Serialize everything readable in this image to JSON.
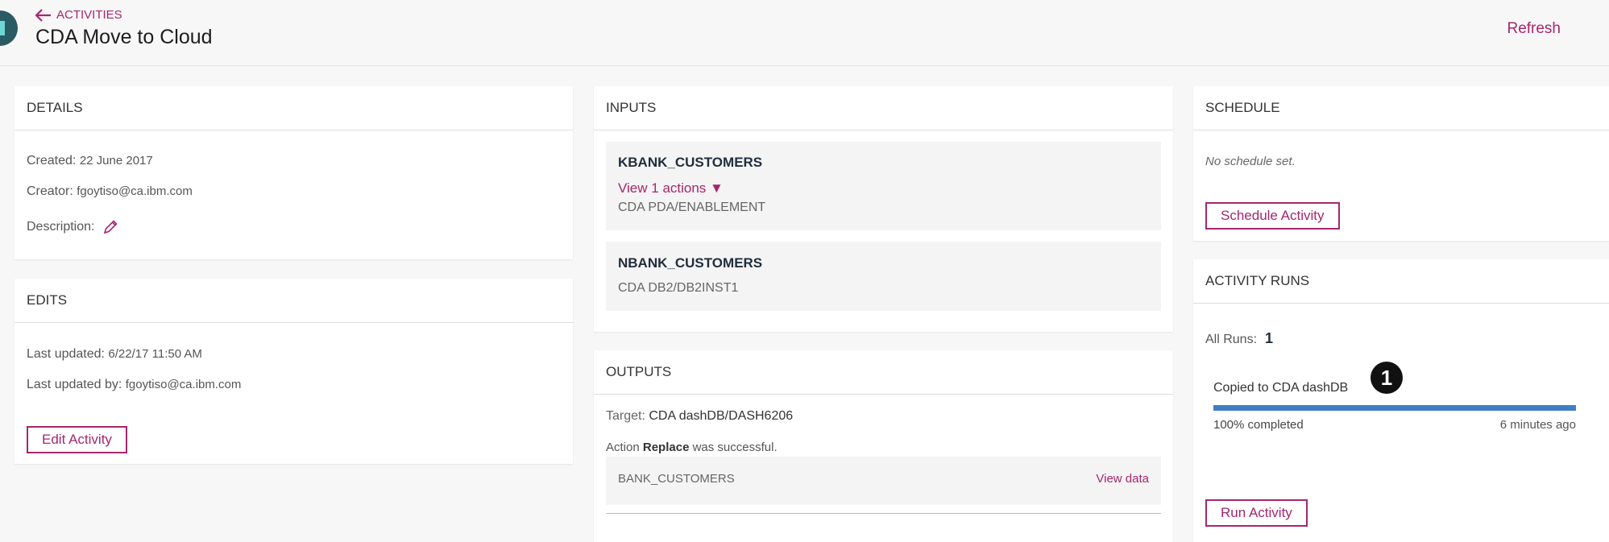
{
  "header": {
    "back_label": "ACTIVITIES",
    "title": "CDA Move to Cloud",
    "refresh_label": "Refresh"
  },
  "details": {
    "heading": "DETAILS",
    "created_label": "Created:",
    "created_value": "22 June 2017",
    "creator_label": "Creator:",
    "creator_value": "fgoytiso@ca.ibm.com",
    "description_label": "Description:"
  },
  "edits": {
    "heading": "EDITS",
    "last_updated_label": "Last updated:",
    "last_updated_value": "6/22/17 11:50 AM",
    "last_updated_by_label": "Last updated by:",
    "last_updated_by_value": "fgoytiso@ca.ibm.com",
    "edit_button": "Edit Activity"
  },
  "inputs": {
    "heading": "INPUTS",
    "items": [
      {
        "name": "KBANK_CUSTOMERS",
        "actions_link": "View 1 actions ▼",
        "source": "CDA PDA/ENABLEMENT"
      },
      {
        "name": "NBANK_CUSTOMERS",
        "source": "CDA DB2/DB2INST1"
      }
    ]
  },
  "outputs": {
    "heading": "OUTPUTS",
    "target_label": "Target:",
    "target_value": "CDA dashDB/DASH6206",
    "action_prefix": "Action",
    "action_name": "Replace",
    "action_suffix": "was successful.",
    "table_name": "BANK_CUSTOMERS",
    "view_data": "View data"
  },
  "schedule": {
    "heading": "SCHEDULE",
    "empty_text": "No schedule set.",
    "schedule_button": "Schedule Activity"
  },
  "activity_runs": {
    "heading": "ACTIVITY RUNS",
    "all_runs_label": "All Runs:",
    "all_runs_count": "1",
    "run_title": "Copied to CDA dashDB",
    "badge": "1",
    "progress_fraction": 1.0,
    "progress_text": "100% completed",
    "time_ago": "6 minutes ago",
    "run_button": "Run Activity"
  },
  "colors": {
    "accent": "#a6266e",
    "progress": "#3f7fc1"
  }
}
